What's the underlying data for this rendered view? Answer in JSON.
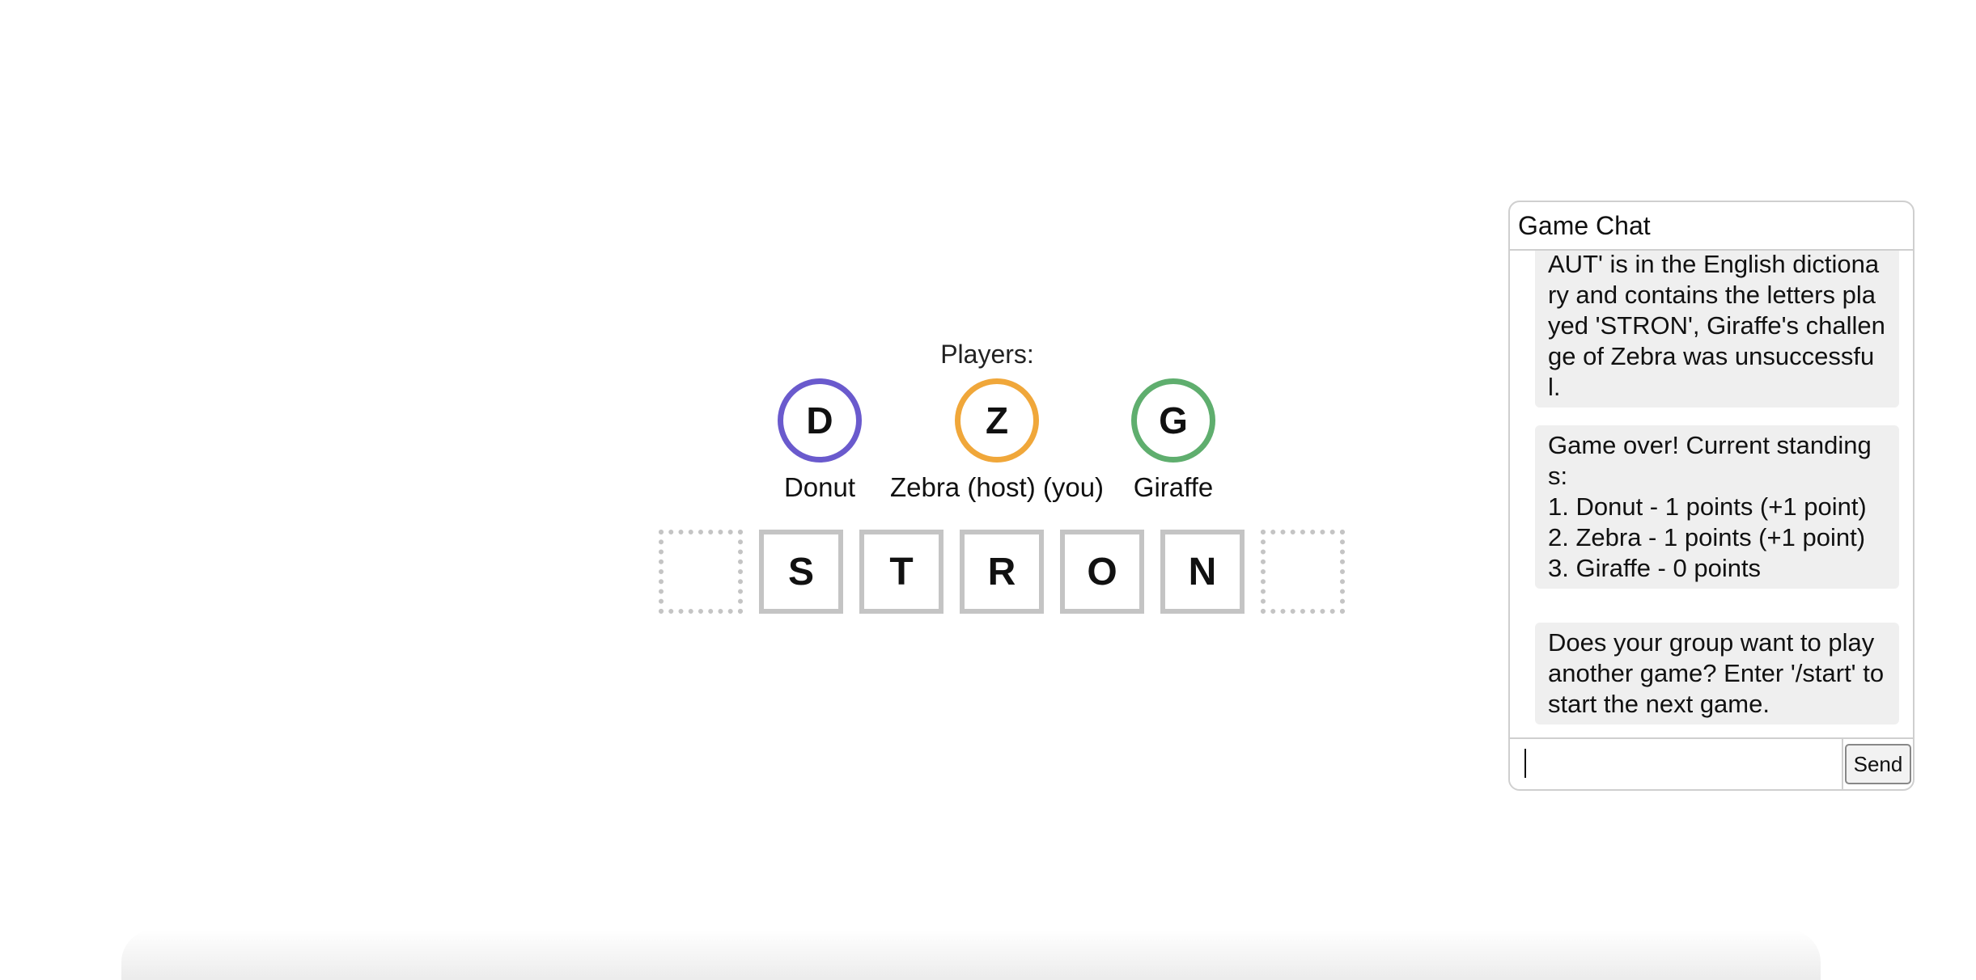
{
  "players": {
    "label": "Players:",
    "list": [
      {
        "initial": "D",
        "name": "Donut",
        "color": "#6a5acd"
      },
      {
        "initial": "Z",
        "name": "Zebra (host) (you)",
        "color": "#f0a73a"
      },
      {
        "initial": "G",
        "name": "Giraffe",
        "color": "#5fae6e"
      }
    ]
  },
  "tiles": [
    "",
    "S",
    "T",
    "R",
    "O",
    "N",
    ""
  ],
  "chat": {
    "title": "Game Chat",
    "messages": [
      "AUT' is in the English dictionary and contains the letters played 'STRON', Giraffe's challenge of Zebra was unsuccessful.",
      "Game over! Current standings:\n1. Donut - 1 points (+1 point)\n2. Zebra - 1 points (+1 point)\n3. Giraffe - 0 points",
      "Does your group want to play another game? Enter '/start' to start the next game."
    ],
    "input_value": "",
    "send_label": "Send"
  }
}
